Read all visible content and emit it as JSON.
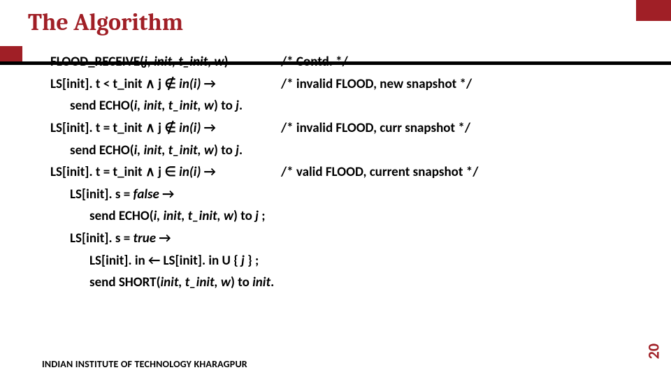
{
  "title": "The Algorithm",
  "line1": {
    "lhs_pre": "FLOOD_RECEIVE(",
    "lhs_args": "j, init, t_init, w",
    "lhs_post": ")",
    "rhs": "/* Contd. */"
  },
  "line2": {
    "a": "LS[init]. t < t_init ",
    "and": "∧",
    "b": " j ",
    "notin": "∉",
    "c": " in(i) ",
    "arrow": "→",
    "rhs": "/* invalid FLOOD, new snapshot */"
  },
  "echo": {
    "pre": "send ECHO(",
    "args": "i, init, t_init, w",
    "post": ") to ",
    "to": "j",
    "end": "."
  },
  "line3": {
    "a": "LS[init]. t = t_init ",
    "and": "∧",
    "b": " j ",
    "notin": "∉",
    "c": " in(i) ",
    "arrow": "→",
    "rhs": "/* invalid FLOOD, curr snapshot */"
  },
  "line4": {
    "a": "LS[init]. t = t_init ",
    "and": "∧",
    "b": " j ",
    "inrel": "∈",
    "c": " in(i) ",
    "arrow": "→",
    "rhs": "/* valid FLOOD, current snapshot */"
  },
  "line5": {
    "a": "LS[init]. s = ",
    "val": "false",
    "arrow": " →"
  },
  "echo2": {
    "pre": "send ECHO(",
    "args": "i, init, t_init, w",
    "post": ") to ",
    "to": "j ",
    "end": ";"
  },
  "line6": {
    "a": "LS[init]. s = ",
    "val": "true",
    "arrow": " →"
  },
  "line7": {
    "a": "LS[init]. in ",
    "larrow": "←",
    "b": " LS[init]. in U { ",
    "j": "j",
    "c": " } ;"
  },
  "short": {
    "pre": "send SHORT(",
    "args": "init, t_init, w",
    "post": ") to ",
    "to": "init",
    "end": "."
  },
  "footer": "INDIAN INSTITUTE OF TECHNOLOGY KHARAGPUR",
  "page": "20"
}
